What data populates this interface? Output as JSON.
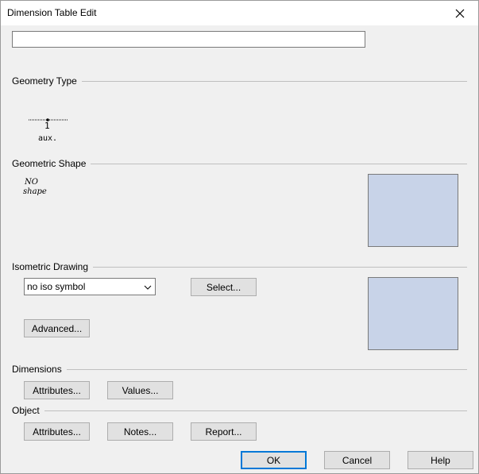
{
  "window": {
    "title": "Dimension Table Edit"
  },
  "name_input": {
    "value": ""
  },
  "sections": {
    "geometry_type": "Geometry Type",
    "geometric_shape": "Geometric Shape",
    "isometric_drawing": "Isometric Drawing",
    "dimensions": "Dimensions",
    "object": "Object"
  },
  "geometry_glyph": {
    "number": "1",
    "caption": "aux."
  },
  "shape_glyph": {
    "line1": "NO",
    "line2": "shape"
  },
  "iso": {
    "selected": "no iso symbol",
    "select_button": "Select...",
    "advanced_button": "Advanced..."
  },
  "dimensions": {
    "attributes_button": "Attributes...",
    "values_button": "Values..."
  },
  "object": {
    "attributes_button": "Attributes...",
    "notes_button": "Notes...",
    "report_button": "Report..."
  },
  "footer": {
    "ok": "OK",
    "cancel": "Cancel",
    "help": "Help"
  },
  "colors": {
    "preview_fill": "#c8d3e8",
    "focus_border": "#0078d7"
  }
}
